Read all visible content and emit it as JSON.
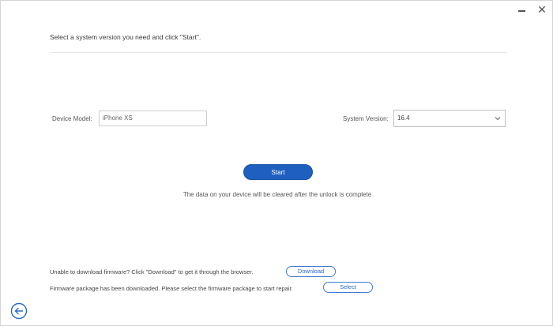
{
  "window": {
    "minimize_icon": "minimize-icon",
    "close_icon": "close-icon",
    "close_glyph": "✕"
  },
  "instruction": "Select a system version you need and click \"Start\".",
  "form": {
    "device_model_label": "Device Model:",
    "device_model_value": "iPhone XS",
    "system_version_label": "System Version:",
    "system_version_value": "16.4"
  },
  "start_label": "Start",
  "warning_text": "The data on your device will be cleared after the unlock is complete",
  "footer": {
    "download_text": "Unable to download firmware? Click \"Download\" to get it through the browser.",
    "download_label": "Download",
    "select_text": "Firmware package has been downloaded. Please select the firmware package to start repair.",
    "select_label": "Select"
  },
  "colors": {
    "accent": "#1f5fbf",
    "link_blue": "#2a6bc8"
  }
}
